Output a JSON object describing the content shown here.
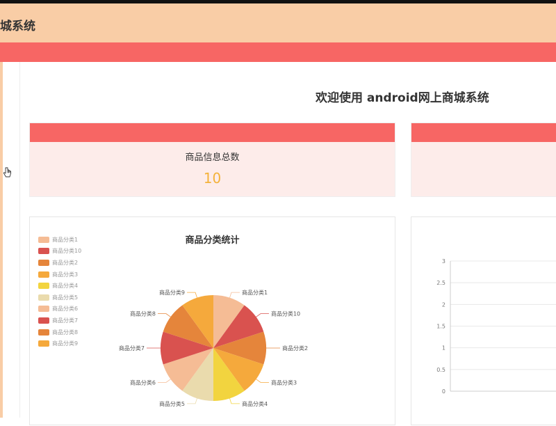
{
  "header": {
    "title": "城系统"
  },
  "welcome": {
    "text": "欢迎使用 android网上商城系统"
  },
  "cards": [
    {
      "label": "商品信息总数",
      "value": "10"
    }
  ],
  "chart_data": [
    {
      "type": "pie",
      "title": "商品分类统计",
      "legend_position": "top-left",
      "categories": [
        "商品分类1",
        "商品分类10",
        "商品分类2",
        "商品分类3",
        "商品分类4",
        "商品分类5",
        "商品分类6",
        "商品分类7",
        "商品分类8",
        "商品分类9"
      ],
      "values": [
        1,
        1,
        1,
        1,
        1,
        1,
        1,
        1,
        1,
        1
      ],
      "colors": [
        "#f5bc95",
        "#d9524f",
        "#e5853b",
        "#f5a93c",
        "#f2d43f",
        "#eadbad",
        "#f5bc95",
        "#d9524f",
        "#e5853b",
        "#f5a93c"
      ]
    },
    {
      "type": "line",
      "yticks": [
        "3",
        "2.5",
        "2",
        "1.5",
        "1",
        "0.5",
        "0"
      ],
      "ylim": [
        0,
        3
      ],
      "grid": true
    }
  ]
}
